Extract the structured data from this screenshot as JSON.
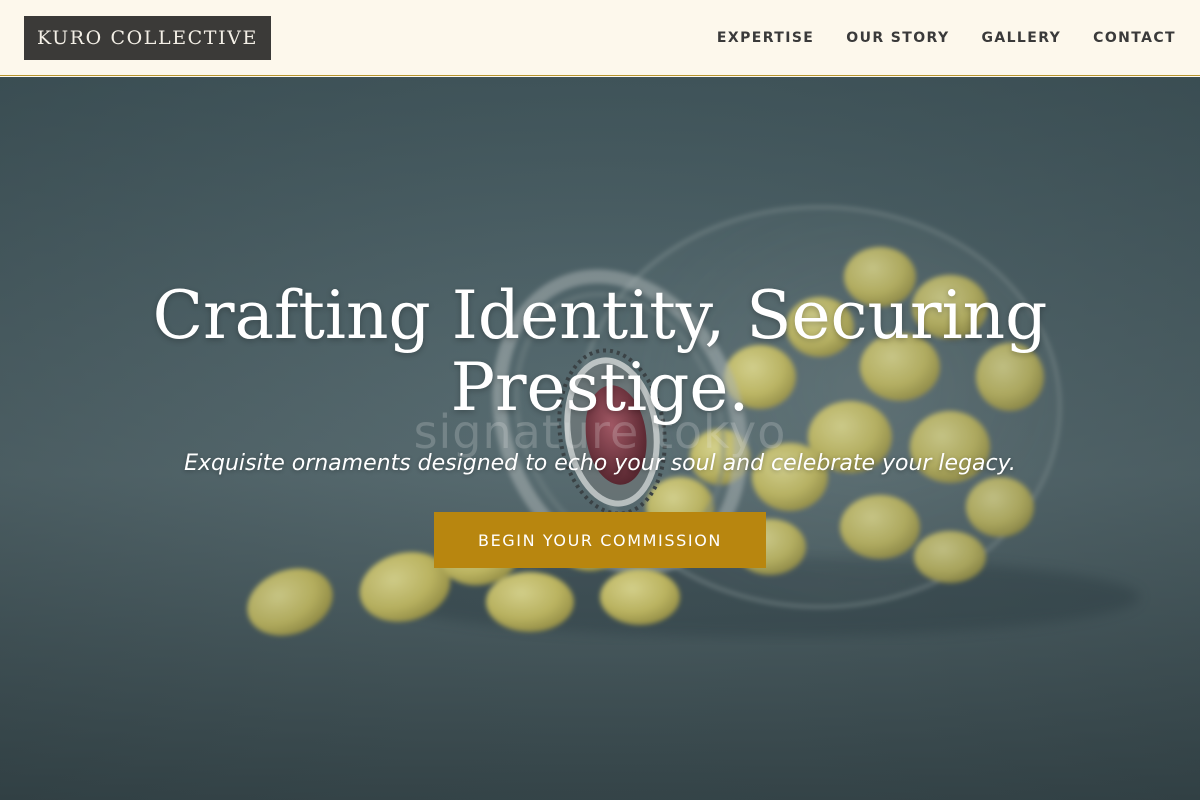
{
  "header": {
    "logo_text": "KURO COLLECTIVE",
    "nav": [
      {
        "label": "EXPERTISE"
      },
      {
        "label": "OUR STORY"
      },
      {
        "label": "GALLERY"
      },
      {
        "label": "CONTACT"
      }
    ]
  },
  "hero": {
    "title": "Crafting Identity, Securing Prestige.",
    "subtitle": "Exquisite ornaments designed to echo your soul and celebrate your legacy.",
    "cta_label": "BEGIN YOUR COMMISSION",
    "watermark": "signature tokyo",
    "image_subject": "glass jar tipped on its side spilling pale yellow candies, with an ornate silver ring with a garnet stone resting at the jar mouth"
  },
  "colors": {
    "header_bg": "#fdf8ec",
    "logo_bg": "#3b3a38",
    "nav_text": "#3a3a3a",
    "accent_gold": "#b8860f",
    "hero_bg": "#4f6468"
  }
}
